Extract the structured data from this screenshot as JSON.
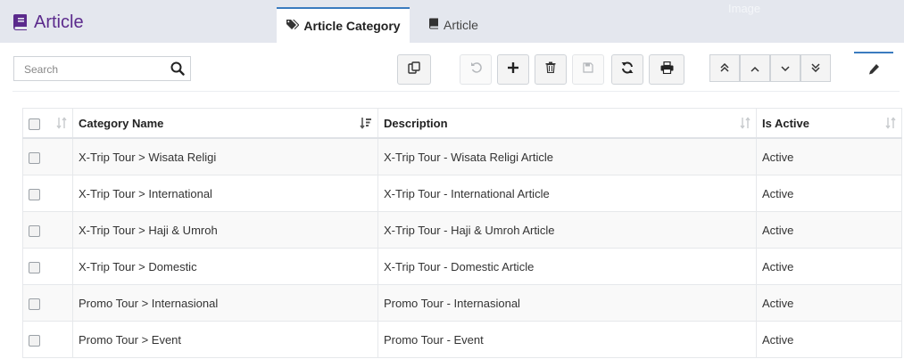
{
  "header": {
    "title": "Article",
    "title_icon": "book-icon",
    "tabs": [
      {
        "label": "Article Category",
        "icon": "tags-icon",
        "active": true
      },
      {
        "label": "Article",
        "icon": "book-icon",
        "active": false
      }
    ],
    "ghost_label": "Image"
  },
  "toolbar": {
    "search_placeholder": "Search",
    "search_value": "",
    "buttons": [
      "copy-icon",
      "undo-icon",
      "add-icon",
      "delete-icon",
      "save-icon",
      "refresh-icon",
      "print-icon"
    ],
    "nav_buttons": [
      "double-chevron-up-icon",
      "chevron-up-icon",
      "chevron-down-icon",
      "double-chevron-down-icon"
    ],
    "edit_icon": "pencil-icon"
  },
  "table": {
    "columns": [
      "Category Name",
      "Description",
      "Is Active"
    ],
    "rows": [
      {
        "name": "X-Trip Tour > Wisata Religi",
        "description": "X-Trip Tour - Wisata Religi Article",
        "active": "Active"
      },
      {
        "name": "X-Trip Tour > International",
        "description": "X-Trip Tour - International Article",
        "active": "Active"
      },
      {
        "name": "X-Trip Tour > Haji & Umroh",
        "description": "X-Trip Tour - Haji & Umroh Article",
        "active": "Active"
      },
      {
        "name": "X-Trip Tour > Domestic",
        "description": "X-Trip Tour - Domestic Article",
        "active": "Active"
      },
      {
        "name": "Promo Tour > Internasional",
        "description": "Promo Tour - Internasional",
        "active": "Active"
      },
      {
        "name": "Promo Tour > Event",
        "description": "Promo Tour - Event",
        "active": "Active"
      }
    ]
  },
  "colors": {
    "title": "#5b2a8c",
    "header_bg": "#e4e7ee",
    "tab_accent": "#3a7bbf"
  }
}
